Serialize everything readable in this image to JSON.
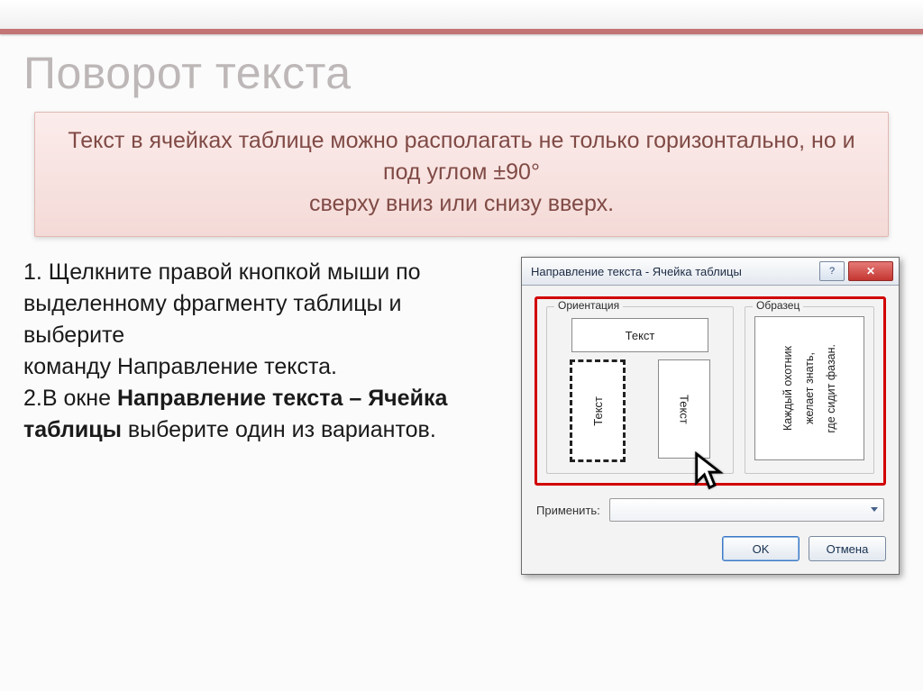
{
  "slide": {
    "title": "Поворот текста",
    "callout_line1": "Текст в ячейках таблице можно располагать не только горизонтально, но и под углом ±90°",
    "callout_line2": "сверху вниз или снизу вверх."
  },
  "instructions": {
    "step1_a": "1. Щелкните правой кнопкой мыши по выделенному фрагменту таблицы и выберите",
    "step1_b": "команду Направление текста.",
    "step2_a": "2.В окне ",
    "step2_bold": "Направление текста – Ячейка таблицы",
    "step2_b": " выберите один из вариантов."
  },
  "dialog": {
    "title": "Направление текста - Ячейка таблицы",
    "help_glyph": "?",
    "close_glyph": "✕",
    "group_orientation": "Ориентация",
    "group_sample": "Образец",
    "option_text": "Текст",
    "sample_lines": [
      "Каждый охотник",
      "желает знать,",
      "где сидит фазан."
    ],
    "apply_label": "Применить:",
    "btn_ok": "OK",
    "btn_cancel": "Отмена"
  }
}
